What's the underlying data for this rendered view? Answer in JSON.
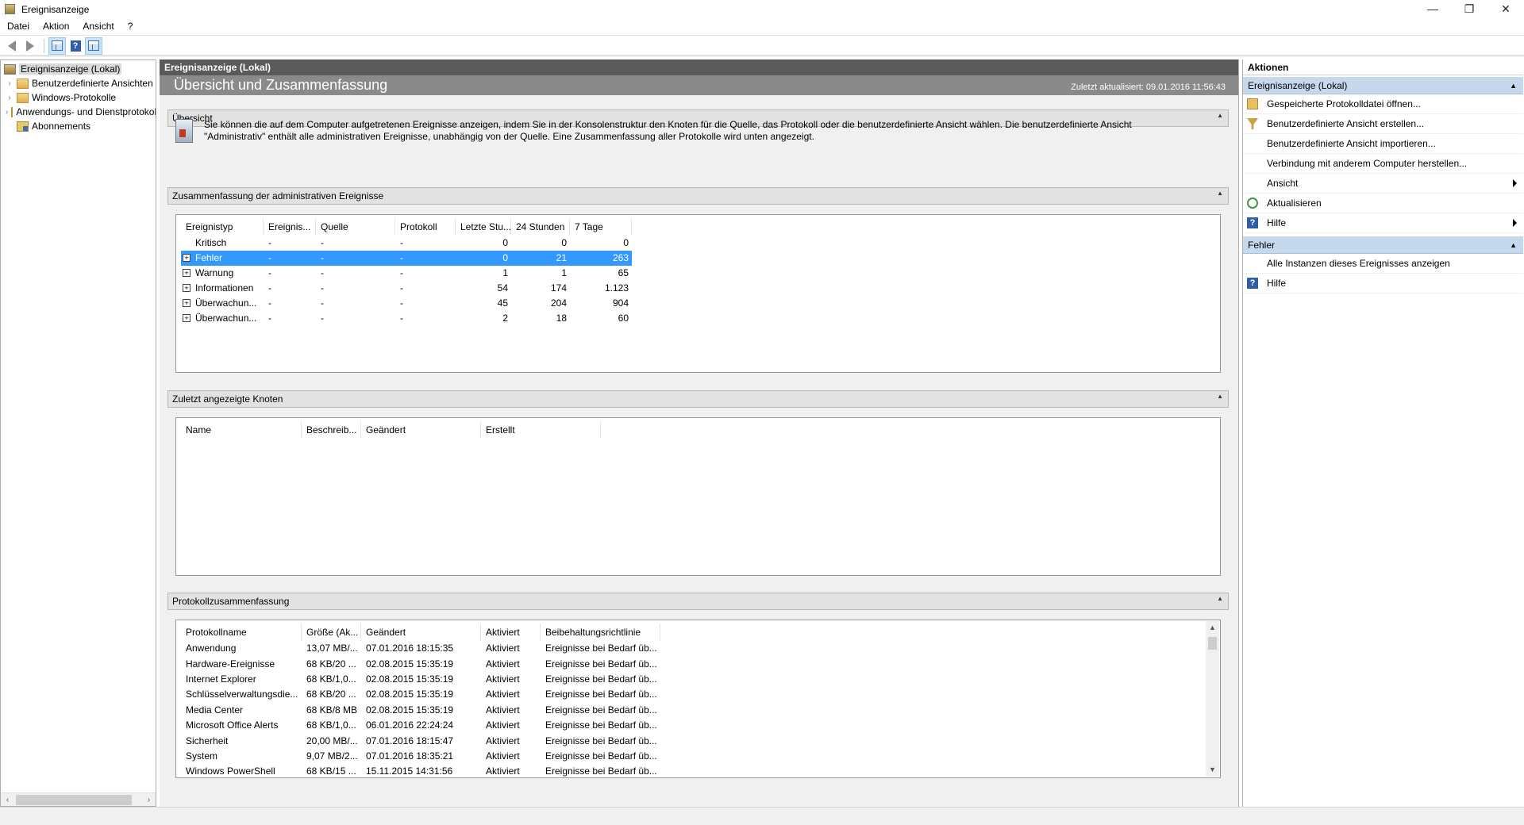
{
  "window": {
    "title": "Ereignisanzeige",
    "minimize": "—",
    "restore": "❐",
    "close": "✕"
  },
  "menu": [
    "Datei",
    "Aktion",
    "Ansicht",
    "?"
  ],
  "tree": {
    "root": "Ereignisanzeige (Lokal)",
    "items": [
      "Benutzerdefinierte Ansichten",
      "Windows-Protokolle",
      "Anwendungs- und Dienstprotokolle",
      "Abonnements"
    ]
  },
  "center": {
    "header": "Ereignisanzeige (Lokal)",
    "banner_title": "Übersicht und Zusammenfassung",
    "last_updated": "Zuletzt aktualisiert: 09.01.2016 11:56:43",
    "overview": {
      "title": "Übersicht",
      "text": "Sie können die auf dem Computer aufgetretenen Ereignisse anzeigen, indem Sie in der Konsolenstruktur den Knoten für die Quelle, das Protokoll oder die benutzerdefinierte Ansicht wählen. Die benutzerdefinierte Ansicht \"Administrativ\" enthält alle administrativen Ereignisse, unabhängig von der Quelle. Eine Zusammenfassung aller Protokolle wird unten angezeigt."
    },
    "admin_summary": {
      "title": "Zusammenfassung der administrativen Ereignisse",
      "columns": [
        "Ereignistyp",
        "Ereignis...",
        "Quelle",
        "Protokoll",
        "Letzte Stu...",
        "24 Stunden",
        "7 Tage"
      ],
      "rows": [
        {
          "type": "Kritisch",
          "id": "-",
          "source": "-",
          "log": "-",
          "hour": "0",
          "day": "0",
          "week": "0"
        },
        {
          "type": "Fehler",
          "id": "-",
          "source": "-",
          "log": "-",
          "hour": "0",
          "day": "21",
          "week": "263"
        },
        {
          "type": "Warnung",
          "id": "-",
          "source": "-",
          "log": "-",
          "hour": "1",
          "day": "1",
          "week": "65"
        },
        {
          "type": "Informationen",
          "id": "-",
          "source": "-",
          "log": "-",
          "hour": "54",
          "day": "174",
          "week": "1.123"
        },
        {
          "type": "Überwachun...",
          "id": "-",
          "source": "-",
          "log": "-",
          "hour": "45",
          "day": "204",
          "week": "904"
        },
        {
          "type": "Überwachun...",
          "id": "-",
          "source": "-",
          "log": "-",
          "hour": "2",
          "day": "18",
          "week": "60"
        }
      ]
    },
    "recent_nodes": {
      "title": "Zuletzt angezeigte Knoten",
      "columns": [
        "Name",
        "Beschreib...",
        "Geändert",
        "Erstellt"
      ]
    },
    "log_summary": {
      "title": "Protokollzusammenfassung",
      "columns": [
        "Protokollname",
        "Größe (Ak...",
        "Geändert",
        "Aktiviert",
        "Beibehaltungsrichtlinie"
      ],
      "rows": [
        {
          "name": "Anwendung",
          "size": "13,07 MB/...",
          "changed": "07.01.2016 18:15:35",
          "enabled": "Aktiviert",
          "policy": "Ereignisse bei Bedarf üb..."
        },
        {
          "name": "Hardware-Ereignisse",
          "size": "68 KB/20 ...",
          "changed": "02.08.2015 15:35:19",
          "enabled": "Aktiviert",
          "policy": "Ereignisse bei Bedarf üb..."
        },
        {
          "name": "Internet Explorer",
          "size": "68 KB/1,0...",
          "changed": "02.08.2015 15:35:19",
          "enabled": "Aktiviert",
          "policy": "Ereignisse bei Bedarf üb..."
        },
        {
          "name": "Schlüsselverwaltungsdie...",
          "size": "68 KB/20 ...",
          "changed": "02.08.2015 15:35:19",
          "enabled": "Aktiviert",
          "policy": "Ereignisse bei Bedarf üb..."
        },
        {
          "name": "Media Center",
          "size": "68 KB/8 MB",
          "changed": "02.08.2015 15:35:19",
          "enabled": "Aktiviert",
          "policy": "Ereignisse bei Bedarf üb..."
        },
        {
          "name": "Microsoft Office Alerts",
          "size": "68 KB/1,0...",
          "changed": "06.01.2016 22:24:24",
          "enabled": "Aktiviert",
          "policy": "Ereignisse bei Bedarf üb..."
        },
        {
          "name": "Sicherheit",
          "size": "20,00 MB/...",
          "changed": "07.01.2016 18:15:47",
          "enabled": "Aktiviert",
          "policy": "Ereignisse bei Bedarf üb..."
        },
        {
          "name": "System",
          "size": "9,07 MB/2...",
          "changed": "07.01.2016 18:35:21",
          "enabled": "Aktiviert",
          "policy": "Ereignisse bei Bedarf üb..."
        },
        {
          "name": "Windows PowerShell",
          "size": "68 KB/15 ...",
          "changed": "15.11.2015 14:31:56",
          "enabled": "Aktiviert",
          "policy": "Ereignisse bei Bedarf üb..."
        }
      ]
    }
  },
  "actions": {
    "title": "Aktionen",
    "group1": {
      "title": "Ereignisanzeige (Lokal)",
      "items": [
        {
          "label": "Gespeicherte Protokolldatei öffnen...",
          "icon": "open-log-icon"
        },
        {
          "label": "Benutzerdefinierte Ansicht erstellen...",
          "icon": "filter-icon"
        },
        {
          "label": "Benutzerdefinierte Ansicht importieren...",
          "icon": ""
        },
        {
          "label": "Verbindung mit anderem Computer herstellen...",
          "icon": ""
        },
        {
          "label": "Ansicht",
          "icon": "",
          "submenu": true
        },
        {
          "label": "Aktualisieren",
          "icon": "refresh-icon"
        },
        {
          "label": "Hilfe",
          "icon": "help-icon",
          "submenu": true
        }
      ]
    },
    "group2": {
      "title": "Fehler",
      "items": [
        {
          "label": "Alle Instanzen dieses Ereignisses anzeigen",
          "icon": ""
        },
        {
          "label": "Hilfe",
          "icon": "help-icon"
        }
      ]
    }
  }
}
